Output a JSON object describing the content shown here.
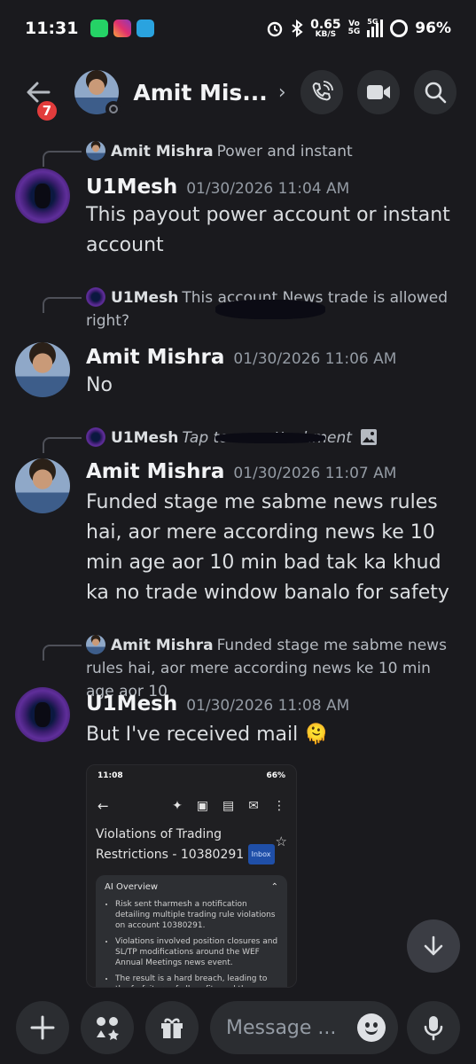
{
  "status_bar": {
    "time": "11:31",
    "net_speed": "0.65",
    "net_unit": "KB/S",
    "signal_a": "Vo",
    "signal_b": "5G",
    "network": "5G",
    "battery": "96%"
  },
  "header": {
    "badge_count": "7",
    "contact_name": "Amit Mis...",
    "actions": [
      "phone-icon",
      "video-icon",
      "search-icon"
    ]
  },
  "messages": [
    {
      "reply_to_name": "Amit Mishra",
      "reply_to_text": "Power and instant",
      "author": "U1Mesh",
      "timestamp": "01/30/2026 11:04 AM",
      "text": "This payout power account or instant account"
    },
    {
      "reply_to_name": "U1Mesh",
      "reply_to_text": "This account News trade is allowed right?",
      "author": "Amit Mishra",
      "timestamp": "01/30/2026 11:06 AM",
      "text": "No"
    },
    {
      "reply_to_name": "U1Mesh",
      "reply_to_text": "Tap to see attachment",
      "author": "Amit Mishra",
      "timestamp": "01/30/2026 11:07 AM",
      "text": "Funded stage me sabme news rules hai, aor mere according news ke 10 min age aor 10 min bad tak ka khud ka no trade window banalo for safety"
    },
    {
      "reply_to_name": "Amit Mishra",
      "reply_to_text": "Funded stage me sabme news rules hai, aor mere according news ke 10 min age aor 10",
      "author": "U1Mesh",
      "timestamp": "01/30/2026 11:08 AM",
      "text": "But I've received mail",
      "emoji": "🫠"
    }
  ],
  "attachment": {
    "status_time": "11:08",
    "status_right": "66%",
    "title": "Violations of Trading Restrictions - 10380291",
    "label": "Inbox",
    "ai_heading": "AI Overview",
    "bullets": [
      "Risk sent tharmesh a notification detailing multiple trading rule violations on account 10380291.",
      "Violations involved position closures and SL/TP modifications around the WEF Annual Meetings news event.",
      "The result is a hard breach, leading to the forfeiture of all profits and the account"
    ]
  },
  "composer": {
    "placeholder": "Message ..."
  }
}
